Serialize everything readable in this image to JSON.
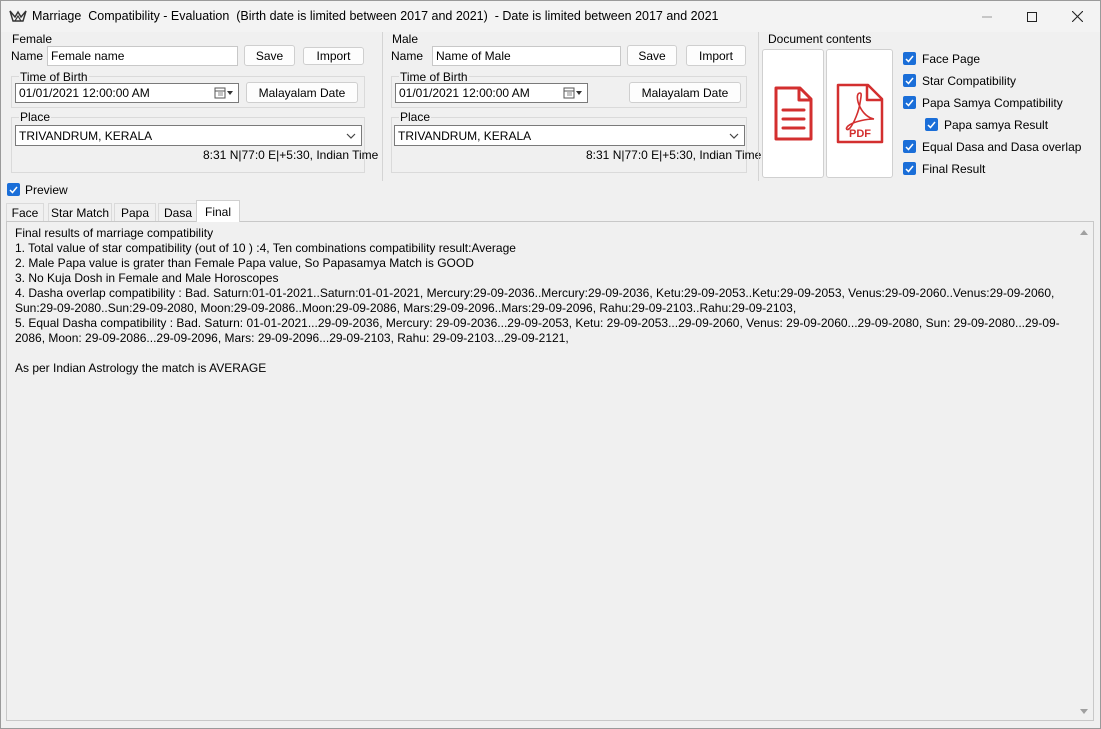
{
  "window": {
    "title": "Marriage  Compatibility - Evaluation  (Birth date is limited between 2017 and 2021)  - Date is limited between 2017 and 2021"
  },
  "female": {
    "group_label": "Female",
    "name_label": "Name",
    "name_value": "Female name",
    "save_label": "Save",
    "import_label": "Import",
    "tob_label": "Time of Birth",
    "tob_value": "01/01/2021  12:00:00 AM",
    "malayalam_label": "Malayalam Date",
    "place_label": "Place",
    "place_value": "TRIVANDRUM, KERALA",
    "coords": "8:31 N|77:0 E|+5:30, Indian Time"
  },
  "male": {
    "group_label": "Male",
    "name_label": "Name",
    "name_value": "Name of Male",
    "save_label": "Save",
    "import_label": "Import",
    "tob_label": "Time of Birth",
    "tob_value": "01/01/2021  12:00:00 AM",
    "malayalam_label": "Malayalam Date",
    "place_label": "Place",
    "place_value": "TRIVANDRUM, KERALA",
    "coords": "8:31 N|77:0 E|+5:30, Indian Time"
  },
  "document": {
    "group_label": "Document contents",
    "pdf_text": "PDF",
    "options": [
      {
        "label": "Face Page",
        "checked": true
      },
      {
        "label": "Star Compatibility",
        "checked": true
      },
      {
        "label": "Papa Samya Compatibility",
        "checked": true
      },
      {
        "label": "Papa samya Result",
        "checked": true
      },
      {
        "label": "Equal Dasa and Dasa overlap",
        "checked": true
      },
      {
        "label": "Final Result",
        "checked": true
      }
    ]
  },
  "preview": {
    "label": "Preview",
    "checked": true
  },
  "tabs": [
    {
      "label": "Face"
    },
    {
      "label": "Star Match"
    },
    {
      "label": "Papa"
    },
    {
      "label": "Dasa"
    },
    {
      "label": "Final",
      "active": true
    }
  ],
  "result_lines": [
    "Final results of marriage compatibility",
    "1. Total value of star compatibility (out of 10 ) :4, Ten combinations compatibility result:Average",
    "2. Male Papa value is grater than Female Papa value, So Papasamya Match is GOOD",
    "3. No Kuja Dosh in Female and Male Horoscopes",
    "4. Dasha overlap compatibility : Bad. Saturn:01-01-2021..Saturn:01-01-2021, Mercury:29-09-2036..Mercury:29-09-2036, Ketu:29-09-2053..Ketu:29-09-2053, Venus:29-09-2060..Venus:29-09-2060, Sun:29-09-2080..Sun:29-09-2080, Moon:29-09-2086..Moon:29-09-2086, Mars:29-09-2096..Mars:29-09-2096, Rahu:29-09-2103..Rahu:29-09-2103,",
    "5. Equal Dasha compatibility : Bad. Saturn: 01-01-2021...29-09-2036, Mercury: 29-09-2036...29-09-2053, Ketu: 29-09-2053...29-09-2060, Venus: 29-09-2060...29-09-2080, Sun: 29-09-2080...29-09-2086, Moon: 29-09-2086...29-09-2096, Mars: 29-09-2096...29-09-2103, Rahu: 29-09-2103...29-09-2121,",
    "",
    "As per Indian Astrology the match is AVERAGE"
  ],
  "colors": {
    "accent": "#1a6ed8",
    "doc_red": "#d32f2f"
  }
}
